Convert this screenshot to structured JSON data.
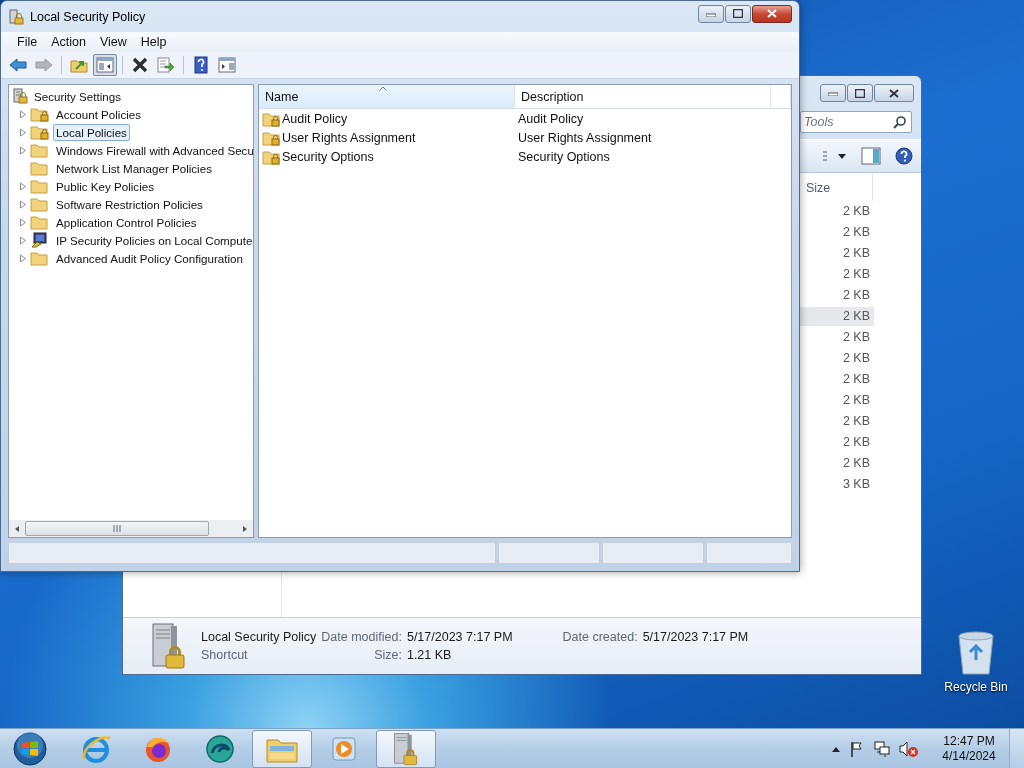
{
  "main_window": {
    "title": "Local Security Policy",
    "menu": [
      "File",
      "Action",
      "View",
      "Help"
    ],
    "toolbar": [
      {
        "kind": "back",
        "disabled": false,
        "pressed": false
      },
      {
        "kind": "forward",
        "disabled": true,
        "pressed": false
      },
      {
        "kind": "up",
        "disabled": false,
        "pressed": false
      },
      {
        "kind": "tree-toggle",
        "disabled": false,
        "pressed": true
      },
      {
        "kind": "delete",
        "disabled": false,
        "pressed": false
      },
      {
        "kind": "export",
        "disabled": false,
        "pressed": false
      },
      {
        "kind": "help",
        "disabled": false,
        "pressed": false
      },
      {
        "kind": "pane-toggle",
        "disabled": false,
        "pressed": false
      }
    ],
    "tree": {
      "label": "Security Settings",
      "children": [
        {
          "label": "Account Policies",
          "kind": "policy-folder",
          "expandable": true,
          "selected": false
        },
        {
          "label": "Local Policies",
          "kind": "policy-folder",
          "expandable": true,
          "selected": true
        },
        {
          "label": "Windows Firewall with Advanced Secu",
          "kind": "folder",
          "expandable": true,
          "selected": false
        },
        {
          "label": "Network List Manager Policies",
          "kind": "folder",
          "expandable": false,
          "selected": false
        },
        {
          "label": "Public Key Policies",
          "kind": "folder",
          "expandable": true,
          "selected": false
        },
        {
          "label": "Software Restriction Policies",
          "kind": "folder",
          "expandable": true,
          "selected": false
        },
        {
          "label": "Application Control Policies",
          "kind": "folder",
          "expandable": true,
          "selected": false
        },
        {
          "label": "IP Security Policies on Local Compute",
          "kind": "computer",
          "expandable": true,
          "selected": false
        },
        {
          "label": "Advanced Audit Policy Configuration",
          "kind": "folder",
          "expandable": true,
          "selected": false
        }
      ]
    },
    "list": {
      "columns": [
        {
          "label": "Name",
          "sorted": true
        },
        {
          "label": "Description",
          "sorted": false
        }
      ],
      "rows": [
        {
          "name": "Audit Policy",
          "description": "Audit Policy"
        },
        {
          "name": "User Rights Assignment",
          "description": "User Rights Assignment"
        },
        {
          "name": "Security Options",
          "description": "Security Options"
        }
      ]
    }
  },
  "explorer_window": {
    "search_placeholder": "Tools",
    "size_column": "Size",
    "sizes": [
      {
        "text": "2 KB",
        "selected": false
      },
      {
        "text": "2 KB",
        "selected": false
      },
      {
        "text": "2 KB",
        "selected": false
      },
      {
        "text": "2 KB",
        "selected": false
      },
      {
        "text": "2 KB",
        "selected": false
      },
      {
        "text": "2 KB",
        "selected": true
      },
      {
        "text": "2 KB",
        "selected": false
      },
      {
        "text": "2 KB",
        "selected": false
      },
      {
        "text": "2 KB",
        "selected": false
      },
      {
        "text": "2 KB",
        "selected": false
      },
      {
        "text": "2 KB",
        "selected": false
      },
      {
        "text": "2 KB",
        "selected": false
      },
      {
        "text": "2 KB",
        "selected": false
      },
      {
        "text": "3 KB",
        "selected": false
      }
    ],
    "details": {
      "name": "Local Security Policy",
      "type": "Shortcut",
      "modified_label": "Date modified:",
      "modified": "5/17/2023 7:17 PM",
      "size_label": "Size:",
      "size": "1.21 KB",
      "created_label": "Date created:",
      "created": "5/17/2023 7:17 PM"
    }
  },
  "desktop_icons": [
    {
      "label": "Recycle Bin"
    }
  ],
  "taskbar": {
    "buttons": [
      {
        "kind": "browser-e",
        "open": false
      },
      {
        "kind": "fox-browser",
        "open": false
      },
      {
        "kind": "swirl-browser",
        "open": false
      },
      {
        "kind": "folder",
        "open": true
      },
      {
        "kind": "media",
        "open": false
      },
      {
        "kind": "server-lock",
        "open": true
      }
    ],
    "volume_muted": true,
    "time": "12:47 PM",
    "date": "4/14/2024"
  }
}
